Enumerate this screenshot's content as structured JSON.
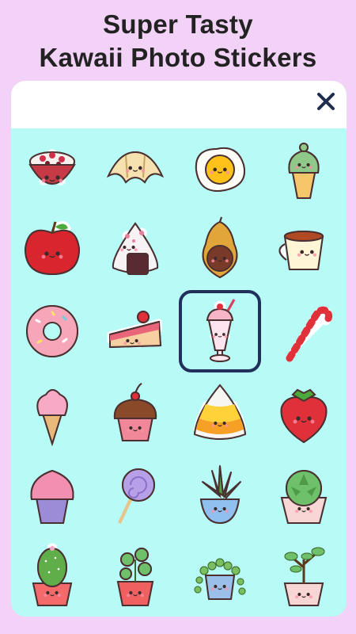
{
  "headline": {
    "line1": "Super Tasty",
    "line2": "Kawaii Photo Stickers"
  },
  "panel": {
    "close_icon": "close-icon"
  },
  "stickers": [
    {
      "name": "rice-bowl-sticker"
    },
    {
      "name": "croissant-sticker"
    },
    {
      "name": "fried-egg-sticker"
    },
    {
      "name": "matcha-ice-cream-sticker"
    },
    {
      "name": "apple-sticker"
    },
    {
      "name": "onigiri-sticker"
    },
    {
      "name": "avocado-sticker"
    },
    {
      "name": "teacup-sticker"
    },
    {
      "name": "donut-sticker"
    },
    {
      "name": "cake-slice-sticker"
    },
    {
      "name": "milkshake-sticker",
      "selected": true
    },
    {
      "name": "candy-cane-sticker"
    },
    {
      "name": "ice-cream-cone-sticker"
    },
    {
      "name": "cupcake-cherry-sticker"
    },
    {
      "name": "candy-corn-sticker"
    },
    {
      "name": "strawberry-sticker"
    },
    {
      "name": "purple-cupcake-sticker"
    },
    {
      "name": "lollipop-sticker"
    },
    {
      "name": "succulent-cup-sticker"
    },
    {
      "name": "succulent-pot-sticker"
    },
    {
      "name": "cactus-pot-sticker"
    },
    {
      "name": "plant-pot-sticker"
    },
    {
      "name": "string-of-pearls-sticker"
    },
    {
      "name": "bonsai-pot-sticker"
    }
  ],
  "colors": {
    "background": "#f3d2f7",
    "panel": "#b8fbf6",
    "selection": "#21305a"
  }
}
